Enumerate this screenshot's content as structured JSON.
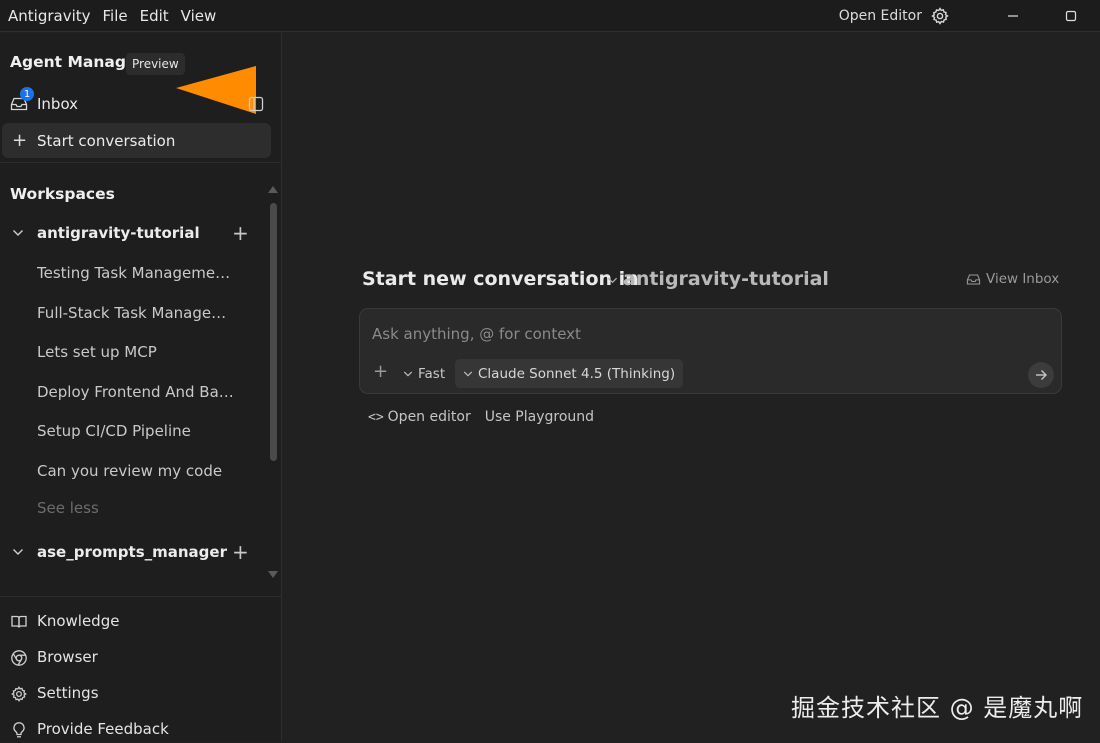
{
  "menubar": {
    "app_name": "Antigravity",
    "file": "File",
    "edit": "Edit",
    "view": "View",
    "open_editor": "Open Editor"
  },
  "sidebar": {
    "title": "Agent Manager",
    "badge": "Preview",
    "inbox": {
      "label": "Inbox",
      "count": "1"
    },
    "start_conversation": "Start conversation",
    "workspaces_title": "Workspaces",
    "workspaces": [
      {
        "name": "antigravity-tutorial",
        "conversations": [
          "Testing Task Management ...",
          "Full-Stack Task Manageme...",
          "Lets set up MCP",
          "Deploy Frontend And Bac...",
          "Setup CI/CD Pipeline",
          "Can you review my code"
        ],
        "see_less": "See less"
      },
      {
        "name": "ase_prompts_manager"
      }
    ],
    "bottom": {
      "knowledge": "Knowledge",
      "browser": "Browser",
      "settings": "Settings",
      "feedback": "Provide Feedback"
    }
  },
  "main": {
    "heading": "Start new conversation in",
    "workspace": "antigravity-tutorial",
    "view_inbox": "View Inbox",
    "composer": {
      "placeholder": "Ask anything, @ for context",
      "mode": "Fast",
      "model": "Claude Sonnet 4.5 (Thinking)"
    },
    "open_editor_link": "Open editor",
    "playground_link": "Use Playground"
  },
  "watermark": "掘金技术社区 @ 是魔丸啊",
  "colors": {
    "background": "#212121",
    "sidebar": "#1e1e1e",
    "accent_badge": "#1a73e8",
    "arrow": "#ff8c00"
  }
}
